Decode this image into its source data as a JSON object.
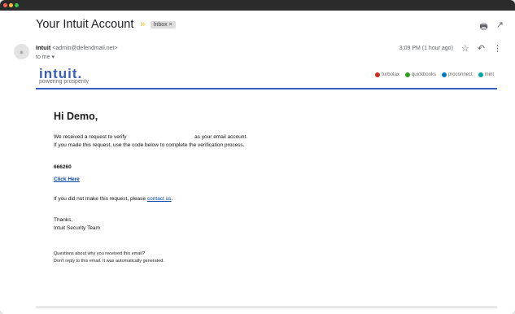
{
  "header": {
    "subject": "Your Intuit Account",
    "importance_marker": "»",
    "label_chip": "Inbox ×"
  },
  "toolbar": {
    "print_icon": "print-icon",
    "popout_icon": "open-in-new-icon"
  },
  "message": {
    "sender_name": "Intuit",
    "sender_email": "<admin@defendmail.net>",
    "to_line": "to me ▾",
    "time": "3:09 PM (1 hour ago)"
  },
  "brand": {
    "logo": "intuit.",
    "tagline": "powering prosperity",
    "products": [
      {
        "name": "turbotax",
        "color": "#d52b1e"
      },
      {
        "name": "quickbooks",
        "color": "#2ca01c"
      },
      {
        "name": "proconnect",
        "color": "#0077c5"
      },
      {
        "name": "mint",
        "color": "#00a6a4"
      }
    ]
  },
  "body": {
    "greeting": "Hi Demo,",
    "line1_start": "We received a request to verify",
    "line1_end": "as your email account.",
    "line2": "If you made this request, use the code below to complete the verification process.",
    "code": "666260",
    "click_here": "Click Here",
    "not_request_start": "If you did not make this request, please",
    "contact_link": "contact us",
    "not_request_end": ".",
    "thanks": "Thanks,",
    "team": "Intuit Security Team",
    "questions": "Questions about why you received this email?",
    "noreply": "Don't reply to this email. It was automatically generated."
  }
}
